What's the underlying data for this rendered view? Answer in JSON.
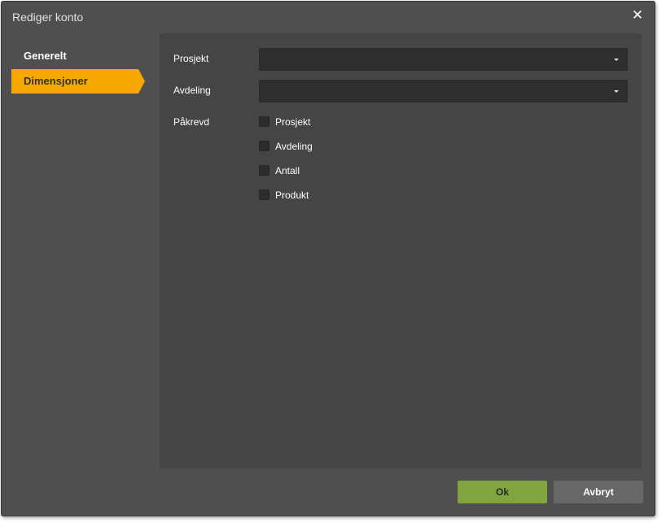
{
  "dialog": {
    "title": "Rediger konto",
    "close_icon": "close-icon"
  },
  "nav": {
    "items": [
      {
        "label": "Generelt",
        "active": false
      },
      {
        "label": "Dimensjoner",
        "active": true
      }
    ]
  },
  "form": {
    "fields": [
      {
        "label": "Prosjekt",
        "value": ""
      },
      {
        "label": "Avdeling",
        "value": ""
      }
    ],
    "required": {
      "label": "Påkrevd",
      "options": [
        {
          "label": "Prosjekt",
          "checked": false
        },
        {
          "label": "Avdeling",
          "checked": false
        },
        {
          "label": "Antall",
          "checked": false
        },
        {
          "label": "Produkt",
          "checked": false
        }
      ]
    }
  },
  "buttons": {
    "ok": "Ok",
    "cancel": "Avbryt"
  },
  "colors": {
    "accent": "#f6a800",
    "ok": "#80a53f",
    "dialog_bg": "#4f4f4f",
    "panel_bg": "#454545"
  }
}
